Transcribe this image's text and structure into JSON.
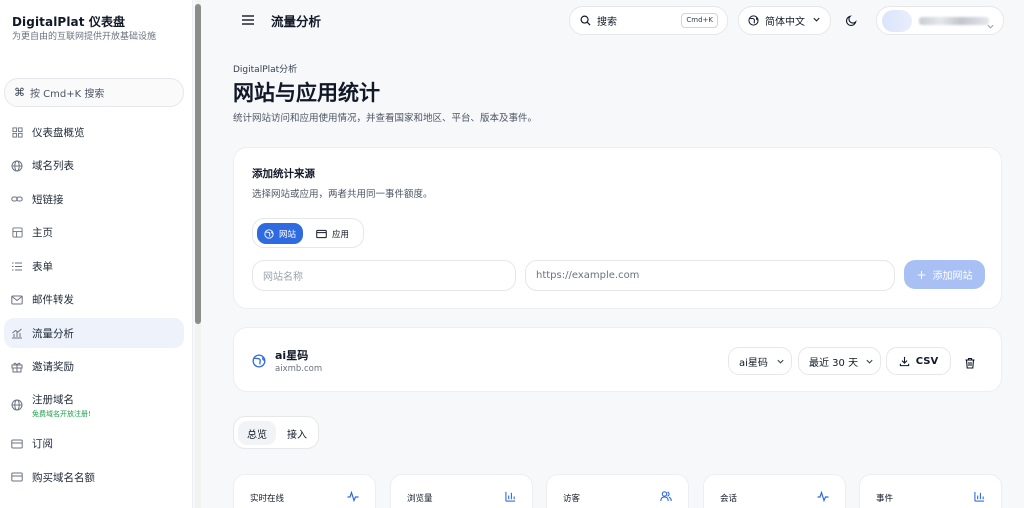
{
  "brand": {
    "title": "DigitalPlat 仪表盘",
    "subtitle": "为更自由的互联网提供开放基础设施"
  },
  "sidebar": {
    "search_label": "按 Cmd+K 搜索",
    "items": [
      {
        "label": "仪表盘概览",
        "icon": "dashboard-icon"
      },
      {
        "label": "域名列表",
        "icon": "globe-icon"
      },
      {
        "label": "短链接",
        "icon": "link-icon"
      },
      {
        "label": "主页",
        "icon": "layout-icon"
      },
      {
        "label": "表单",
        "icon": "list-icon"
      },
      {
        "label": "邮件转发",
        "icon": "mail-icon"
      },
      {
        "label": "流量分析",
        "icon": "chart-icon"
      },
      {
        "label": "邀请奖励",
        "icon": "gift-icon"
      },
      {
        "label": "注册域名",
        "icon": "globe-icon",
        "sub": "免费域名开放注册!"
      },
      {
        "label": "订阅",
        "icon": "card-icon"
      },
      {
        "label": "购买域名名额",
        "icon": "card-icon"
      }
    ],
    "active_index": 6
  },
  "header": {
    "title": "流量分析",
    "search_label": "搜索",
    "search_shortcut": "Cmd+K",
    "language": "简体中文"
  },
  "page": {
    "breadcrumb": "DigitalPlat分析",
    "title": "网站与应用统计",
    "description": "统计网站访问和应用使用情况，并查看国家和地区、平台、版本及事件。"
  },
  "add_source": {
    "title": "添加统计来源",
    "description": "选择网站或应用，两者共用同一事件额度。",
    "type_website": "网站",
    "type_app": "应用",
    "name_placeholder": "网站名称",
    "url_placeholder": "https://example.com",
    "add_button": "添加网站"
  },
  "site": {
    "name": "ai星码",
    "domain": "aixmb.com",
    "site_select": "ai星码",
    "range_select": "最近 30 天",
    "export_label": "CSV"
  },
  "tabs": [
    {
      "label": "总览"
    },
    {
      "label": "接入"
    }
  ],
  "stats": [
    {
      "label": "实时在线",
      "icon": "activity-icon"
    },
    {
      "label": "浏览量",
      "icon": "bar-chart-icon"
    },
    {
      "label": "访客",
      "icon": "users-icon"
    },
    {
      "label": "会话",
      "icon": "activity-icon"
    },
    {
      "label": "事件",
      "icon": "bar-chart-icon"
    }
  ],
  "colors": {
    "accent": "#2f6be0",
    "accent_disabled": "#a9c0f5",
    "success": "#16a34a"
  }
}
